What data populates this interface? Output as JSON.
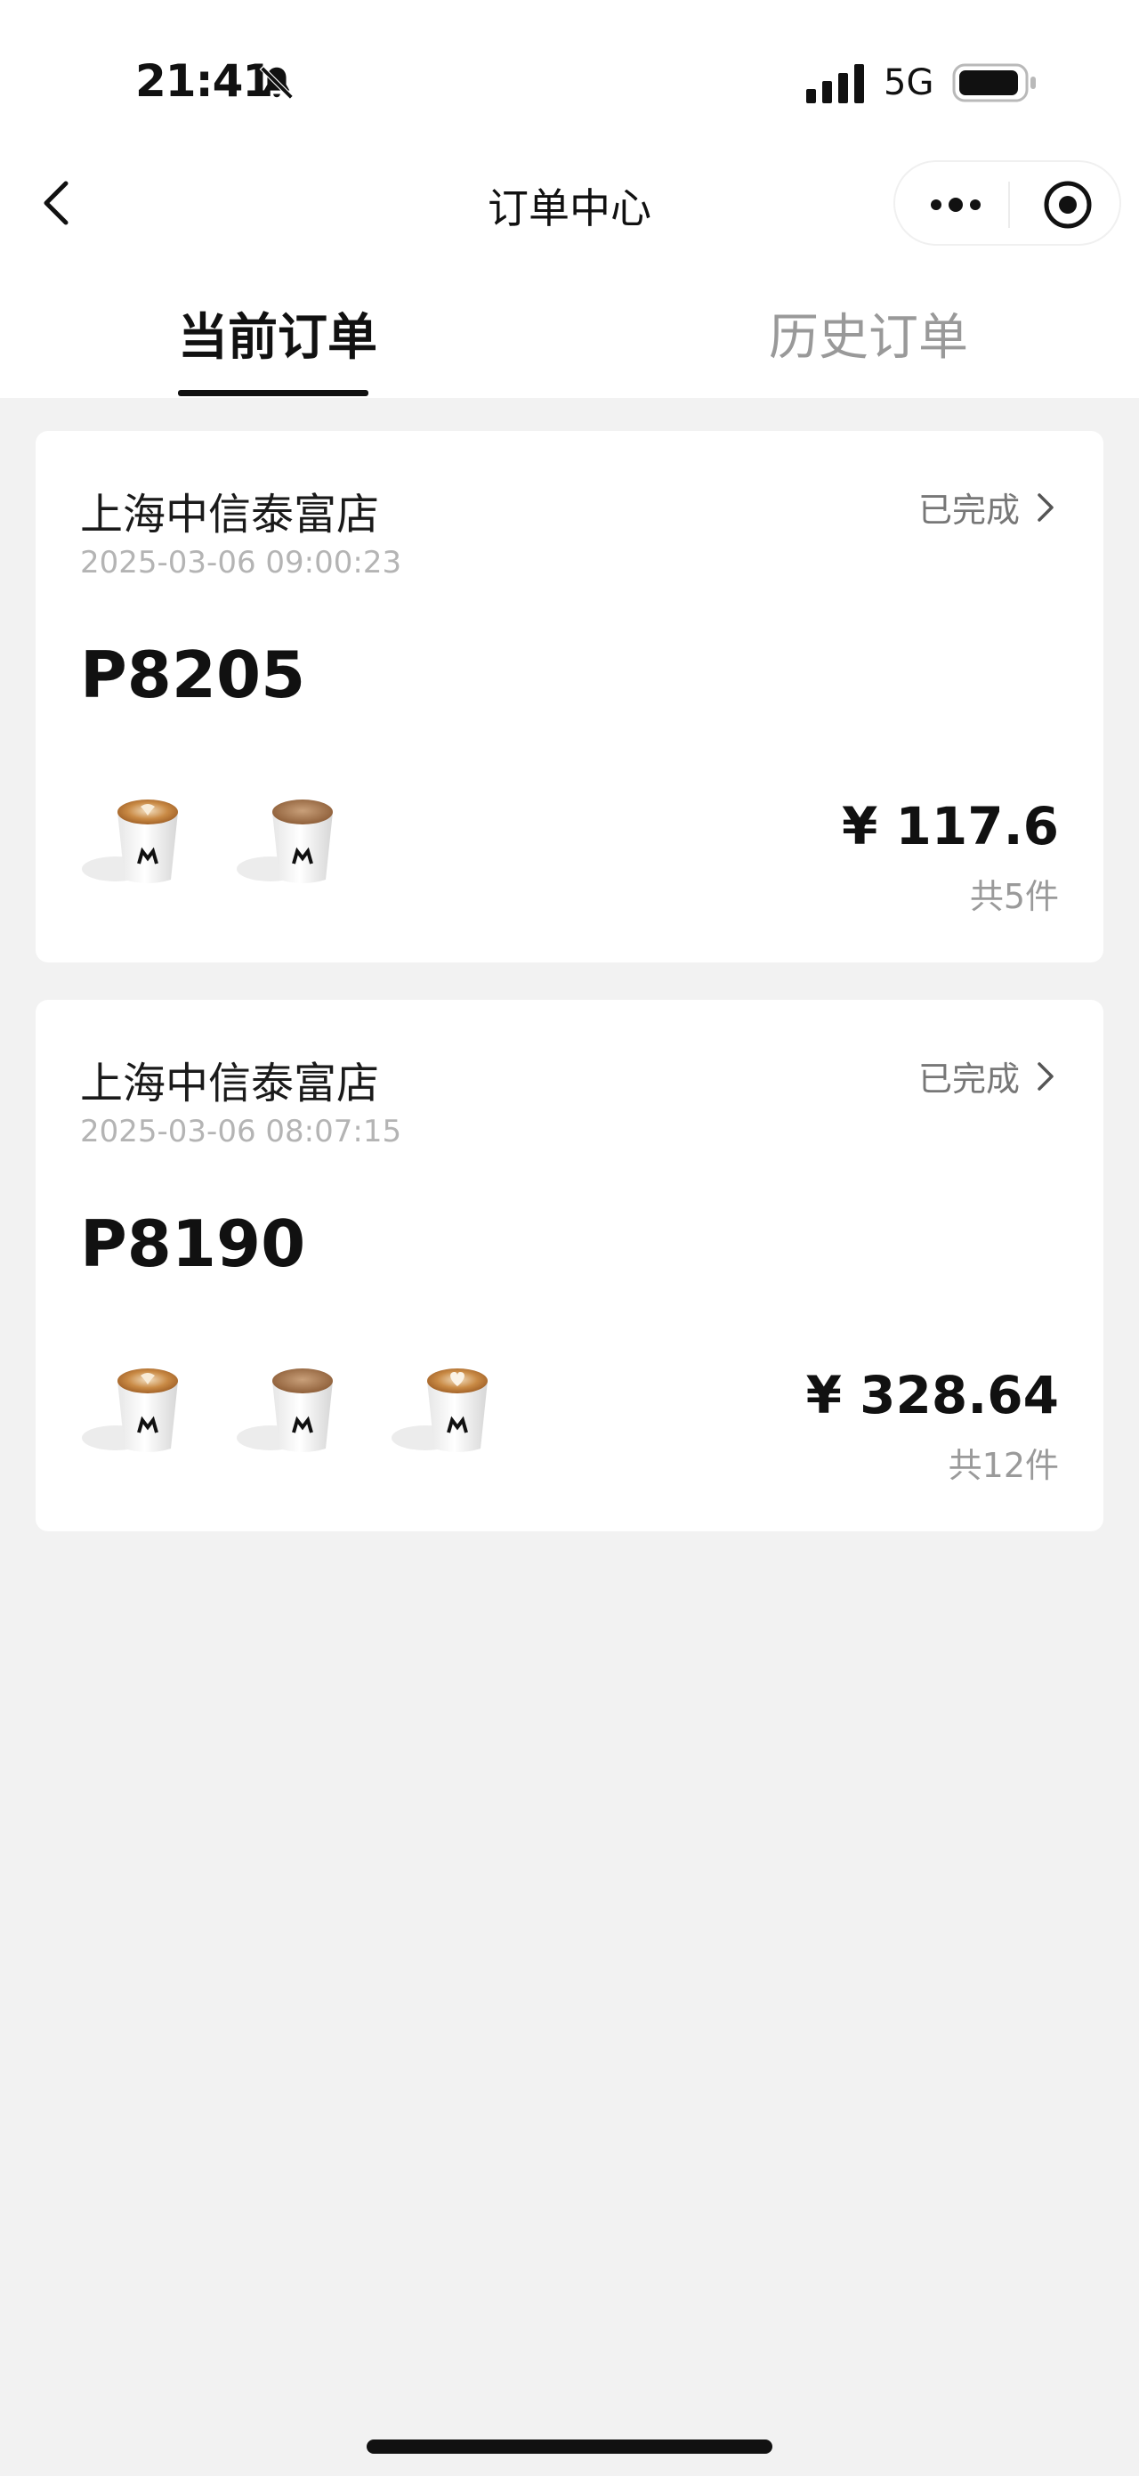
{
  "status_bar": {
    "time": "21:41",
    "network": "5G"
  },
  "nav": {
    "title": "订单中心"
  },
  "tabs": [
    {
      "label": "当前订单",
      "active": true
    },
    {
      "label": "历史订单",
      "active": false
    }
  ],
  "orders": [
    {
      "store": "上海中信泰富店",
      "time": "2025-03-06 09:00:23",
      "status": "已完成",
      "code": "P8205",
      "price": "¥ 117.6",
      "count": "共5件"
    },
    {
      "store": "上海中信泰富店",
      "time": "2025-03-06 08:07:15",
      "status": "已完成",
      "code": "P8190",
      "price": "¥ 328.64",
      "count": "共12件"
    }
  ],
  "colors": {
    "background": "#f2f2f2",
    "card": "#ffffff",
    "muted": "#999999"
  }
}
